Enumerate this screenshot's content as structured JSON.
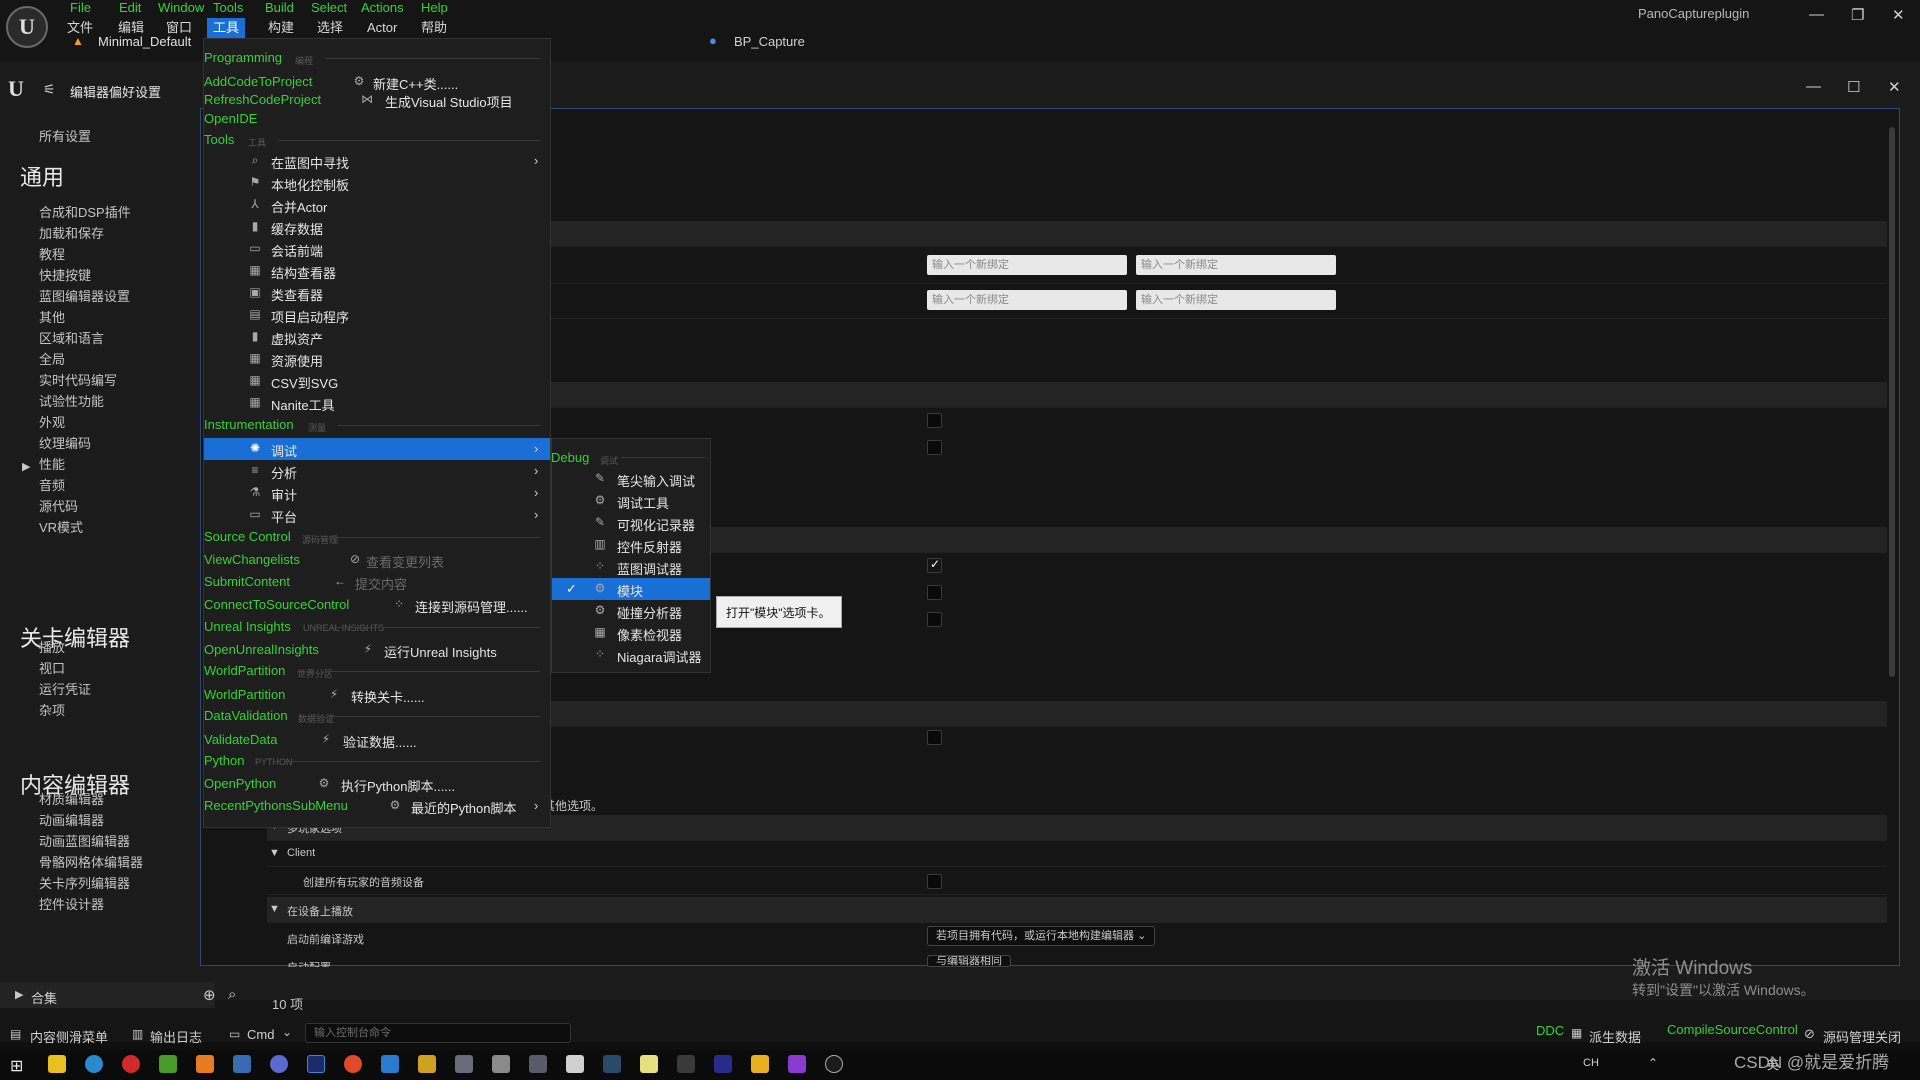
{
  "app": {
    "menu_en": [
      "File",
      "Edit",
      "Window",
      "Tools",
      "Build",
      "Select",
      "Actions",
      "Help"
    ],
    "menu_zh": [
      "文件",
      "编辑",
      "窗口",
      "工具",
      "构建",
      "选择",
      "Actor",
      "帮助"
    ],
    "project_tab": "Minimal_Default",
    "asset_tab": "BP_Capture",
    "plugin_title": "PanoCaptureplugin",
    "win_min": "—",
    "win_restore": "❐",
    "win_close": "✕"
  },
  "prefs_window": {
    "title": "编辑器偏好设置",
    "all_settings": "所有设置",
    "sections": [
      {
        "heading": "通用",
        "items": [
          "合成和DSP插件",
          "加载和保存",
          "教程",
          "快捷按键",
          "蓝图编辑器设置",
          "其他",
          "区域和语言",
          "全局",
          "实时代码编写",
          "试验性功能",
          "外观",
          "纹理编码",
          "性能",
          "音频",
          "源代码",
          "VR模式"
        ]
      },
      {
        "heading": "关卡编辑器",
        "items": [
          "播放",
          "视口",
          "运行凭证",
          "杂项"
        ]
      },
      {
        "heading": "内容编辑器",
        "items": [
          "材质编辑器",
          "动画编辑器",
          "动画蓝图编辑器",
          "骨骼网格体编辑器",
          "关卡序列编辑器",
          "控件设计器"
        ]
      }
    ],
    "binding_placeholder": "输入一个新绑定",
    "other_options_text": "其他选项。",
    "multiplayer_label": "多玩家选项",
    "client_label": "Client",
    "create_audio_label": "创建所有玩家的音频设备",
    "play_on_device_label": "在设备上播放",
    "compile_label": "启动前编译游戏",
    "compile_value": "若项目拥有代码，或运行本地构建编辑器",
    "launch_config_label": "启动配置",
    "launch_config_value": "与编辑器相同"
  },
  "tools_menu": {
    "programming": {
      "title": "Programming",
      "zh": "编程",
      "rows": [
        {
          "en": "AddCodeToProject",
          "label": "新建C++类......",
          "icon": "cpp-class-icon"
        },
        {
          "en": "RefreshCodeProject",
          "label": "生成Visual Studio项目",
          "icon": "visual-studio-icon"
        },
        {
          "en": "OpenIDE",
          "label": "",
          "icon": ""
        }
      ]
    },
    "tools": {
      "title": "Tools",
      "zh": "工具",
      "rows": [
        {
          "label": "在蓝图中寻找",
          "icon": "find-icon",
          "submenu": true
        },
        {
          "label": "本地化控制板",
          "icon": "flag-icon"
        },
        {
          "label": "合并Actor",
          "icon": "merge-icon"
        },
        {
          "label": "缓存数据",
          "icon": "chart-icon"
        },
        {
          "label": "会话前端",
          "icon": "session-icon"
        },
        {
          "label": "结构查看器",
          "icon": "struct-icon"
        },
        {
          "label": "类查看器",
          "icon": "class-icon"
        },
        {
          "label": "项目启动程序",
          "icon": "launcher-icon"
        },
        {
          "label": "虚拟资产",
          "icon": "chart-icon"
        },
        {
          "label": "资源使用",
          "icon": "table-icon"
        },
        {
          "label": "CSV到SVG",
          "icon": "csv-icon"
        },
        {
          "label": "Nanite工具",
          "icon": "nanite-icon"
        }
      ]
    },
    "instrumentation": {
      "title": "Instrumentation",
      "zh": "测量",
      "rows": [
        {
          "label": "调试",
          "icon": "debug-icon",
          "submenu": true,
          "active": true
        },
        {
          "label": "分析",
          "icon": "profile-icon",
          "submenu": true
        },
        {
          "label": "审计",
          "icon": "audit-icon",
          "submenu": true
        },
        {
          "label": "平台",
          "icon": "platform-icon",
          "submenu": true
        }
      ]
    },
    "source_control": {
      "title": "Source Control",
      "zh": "源码管理",
      "rows": [
        {
          "en": "ViewChangelists",
          "label": "查看变更列表",
          "icon": "changelist-icon",
          "disabled": true
        },
        {
          "en": "SubmitContent",
          "label": "提交内容",
          "icon": "submit-icon",
          "disabled": true
        },
        {
          "en": "ConnectToSourceControl",
          "label": "连接到源码管理......",
          "icon": "connect-icon"
        }
      ]
    },
    "insights": {
      "title": "Unreal Insights",
      "zh": "UNREAL INSIGHTS",
      "rows": [
        {
          "en": "OpenUnrealInsights",
          "label": "运行Unreal Insights",
          "icon": "insights-icon"
        }
      ]
    },
    "world_partition": {
      "title": "WorldPartition",
      "zh": "世界分区",
      "rows": [
        {
          "en": "WorldPartition",
          "label": "转换关卡......",
          "icon": "convert-icon"
        }
      ]
    },
    "data_validation": {
      "title": "DataValidation",
      "zh": "数据验证",
      "rows": [
        {
          "en": "ValidateData",
          "label": "验证数据......",
          "icon": "validate-icon"
        }
      ]
    },
    "python": {
      "title": "Python",
      "zh": "PYTHON",
      "rows": [
        {
          "en": "OpenPython",
          "label": "执行Python脚本......",
          "icon": "python-icon"
        },
        {
          "en": "RecentPythonsSubMenu",
          "label": "最近的Python脚本",
          "icon": "python-recent-icon",
          "submenu": true
        }
      ]
    }
  },
  "debug_submenu": {
    "title": "Debug",
    "zh": "调试",
    "items": [
      "笔尖输入调试",
      "调试工具",
      "可视化记录器",
      "控件反射器",
      "蓝图调试器",
      "模块",
      "碰撞分析器",
      "像素检视器",
      "Niagara调试器"
    ],
    "checked": "模块"
  },
  "tooltip": "打开\"模块\"选项卡。",
  "bottom": {
    "collections": "合集",
    "item_count": "10 项",
    "content_drawer": "内容侧滑菜单",
    "output_log": "输出日志",
    "cmd": "Cmd",
    "console_placeholder": "输入控制台命令",
    "ddc": "DDC",
    "derived_data": "派生数据",
    "compile_sc": "CompileSourceControl",
    "sc_off": "源码管理关闭"
  },
  "watermark": {
    "line1": "激活 Windows",
    "line2": "转到\"设置\"以激活 Windows。",
    "csdn": "CSDN @就是爱折腾"
  },
  "taskbar": {
    "ime": "英",
    "lang": "CH"
  },
  "colors": {
    "accent": "#1a6fd6",
    "green": "#35d335",
    "menu_bg": "#1e1e1e"
  }
}
